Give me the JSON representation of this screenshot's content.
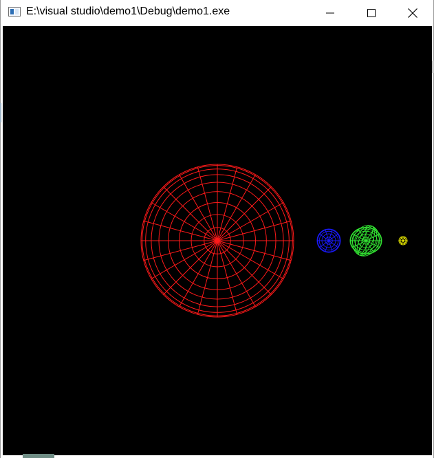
{
  "window": {
    "title": "E:\\visual studio\\demo1\\Debug\\demo1.exe",
    "icon": "app-window-icon",
    "controls": [
      {
        "name": "minimize",
        "icon": "minimize-icon"
      },
      {
        "name": "maximize",
        "icon": "maximize-icon"
      },
      {
        "name": "close",
        "icon": "close-icon"
      }
    ]
  },
  "scene": {
    "background": "#000000",
    "objects": [
      {
        "name": "red-sphere",
        "color": "#ff1a1a",
        "style": "wireframe"
      },
      {
        "name": "blue-sphere",
        "color": "#1a1aff",
        "style": "wireframe"
      },
      {
        "name": "green-sphere",
        "color": "#33e633",
        "style": "wireframe"
      },
      {
        "name": "yellow-sphere",
        "color": "#ffff00",
        "style": "wireframe"
      }
    ]
  }
}
